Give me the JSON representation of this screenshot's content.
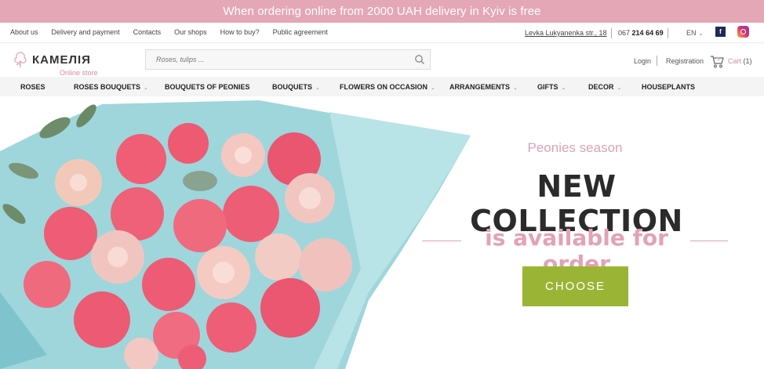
{
  "promo": {
    "text": "When ordering online from 2000 UAH delivery in Kyiv is free"
  },
  "topbar": {
    "links": [
      "About us",
      "Delivery and payment",
      "Contacts",
      "Our shops",
      "How to buy?",
      "Public agreement"
    ],
    "address": "Levka Lukyanenka str., 18",
    "phone_prefix": "067",
    "phone_number": "214 64 69",
    "language": "EN",
    "language_chevron": "⌄",
    "facebook_letter": "f"
  },
  "header": {
    "logo_text": "КАМЕЛІЯ",
    "logo_sub": "Online store",
    "search_placeholder": "Roses, tulips ...",
    "login": "Login",
    "registration": "Registration",
    "cart_label": "Cart",
    "cart_count": "(1)"
  },
  "nav": {
    "items": [
      {
        "label": "ROSES",
        "chevron": ""
      },
      {
        "label": "ROSES BOUQUETS",
        "chevron": "⌄"
      },
      {
        "label": "BOUQUETS OF PEONIES",
        "chevron": ""
      },
      {
        "label": "BOUQUETS",
        "chevron": "⌄"
      },
      {
        "label": "FLOWERS ON OCCASION",
        "chevron": "⌄"
      },
      {
        "label": "ARRANGEMENTS",
        "chevron": "⌄"
      },
      {
        "label": "GIFTS",
        "chevron": "⌄"
      },
      {
        "label": "DECOR",
        "chevron": "⌄"
      },
      {
        "label": "HOUSEPLANTS",
        "chevron": ""
      }
    ]
  },
  "hero": {
    "season": "Peonies season",
    "title": "NEW COLLECTION",
    "subtitle": "is available for order",
    "button": "CHOOSE"
  },
  "colors": {
    "promo_bg": "#e4a7b6",
    "accent_pink": "#e3a2b5",
    "button_green": "#9ab535",
    "wrap_blue": "#8fd0d8"
  },
  "icons": [
    "search-icon",
    "cart-icon",
    "facebook-icon",
    "instagram-icon",
    "logo-flower-icon",
    "chevron-down-icon"
  ]
}
